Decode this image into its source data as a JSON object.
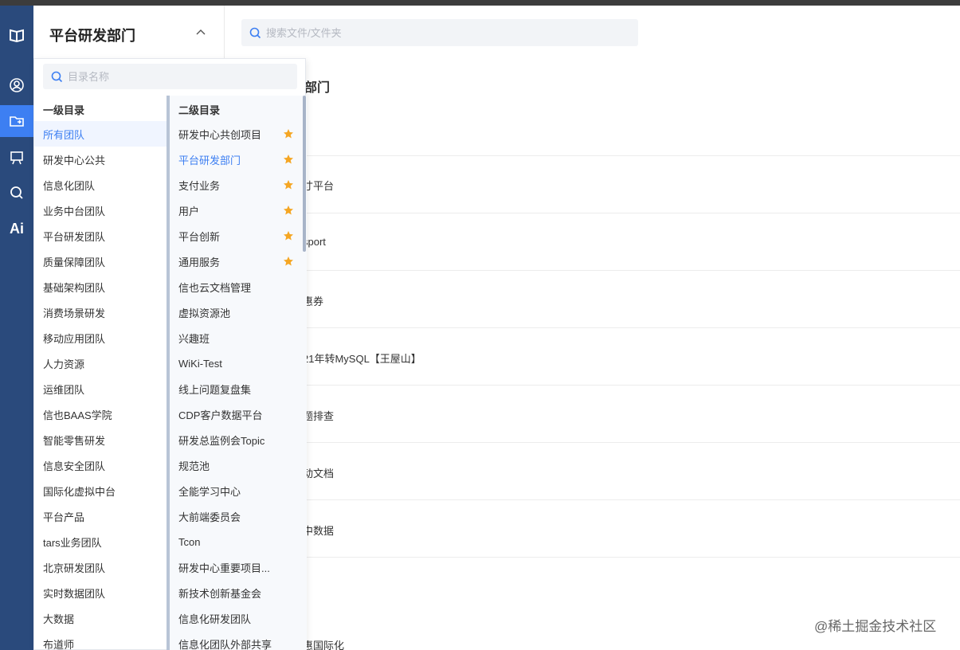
{
  "header": {
    "department_title": "平台研发部门",
    "file_search_placeholder": "搜索文件/文件夹"
  },
  "dropdown": {
    "search_placeholder": "目录名称",
    "level1_heading": "一级目录",
    "level2_heading": "二级目录",
    "level1_items": [
      "所有团队",
      "研发中心公共",
      "信息化团队",
      "业务中台团队",
      "平台研发团队",
      "质量保障团队",
      "基础架构团队",
      "消费场景研发",
      "移动应用团队",
      "人力资源",
      "运维团队",
      "信也BAAS学院",
      "智能零售研发",
      "信息安全团队",
      "国际化虚拟中台",
      "平台产品",
      "tars业务团队",
      "北京研发团队",
      "实时数据团队",
      "大数据",
      "布道师"
    ],
    "level1_selected": 0,
    "level2_items": [
      {
        "label": "研发中心共创项目",
        "starred": true
      },
      {
        "label": "平台研发部门",
        "starred": true
      },
      {
        "label": "支付业务",
        "starred": true
      },
      {
        "label": "用户",
        "starred": true
      },
      {
        "label": "平台创新",
        "starred": true
      },
      {
        "label": "通用服务",
        "starred": true
      },
      {
        "label": "信也云文档管理",
        "starred": false
      },
      {
        "label": "虚拟资源池",
        "starred": false
      },
      {
        "label": "兴趣班",
        "starred": false
      },
      {
        "label": "WiKi-Test",
        "starred": false
      },
      {
        "label": "线上问题复盘集",
        "starred": false
      },
      {
        "label": "CDP客户数据平台",
        "starred": false
      },
      {
        "label": "研发总监例会Topic",
        "starred": false
      },
      {
        "label": "规范池",
        "starred": false
      },
      {
        "label": "全能学习中心",
        "starred": false
      },
      {
        "label": "大前端委员会",
        "starred": false
      },
      {
        "label": "Tcon",
        "starred": false
      },
      {
        "label": "研发中心重要项目...",
        "starred": false
      },
      {
        "label": "新技术创新基金会",
        "starred": false
      },
      {
        "label": "信息化研发团队",
        "starred": false
      },
      {
        "label": "信息化团队外部共享",
        "starred": false
      }
    ],
    "level2_selected": 1
  },
  "background": {
    "heading_fragment": "部门",
    "rows": [
      "寸平台",
      "sport",
      "惠券",
      "21年转MySQL【王屋山】",
      "题排查",
      "动文档",
      "中数据",
      "",
      "惠国际化"
    ]
  },
  "watermark": "@稀土掘金技术社区",
  "colors": {
    "rail": "#2a4a7c",
    "accent": "#3d7ff2",
    "star": "#f5a623"
  }
}
